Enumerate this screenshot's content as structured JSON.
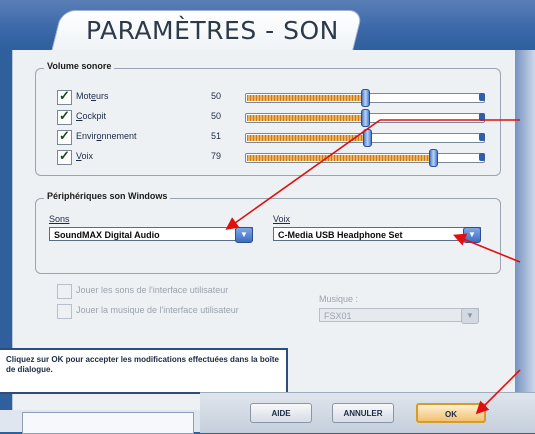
{
  "window": {
    "title": "PARAMÈTRES - SON"
  },
  "volume_group": {
    "title": "Volume sonore",
    "rows": [
      {
        "label_pre": "Mot",
        "label_ul": "e",
        "label_post": "urs",
        "value": "50",
        "level": 0.5,
        "checked": true
      },
      {
        "label_pre": "",
        "label_ul": "C",
        "label_post": "ockpit",
        "value": "50",
        "level": 0.5,
        "checked": true
      },
      {
        "label_pre": "Envir",
        "label_ul": "o",
        "label_post": "nnement",
        "value": "51",
        "level": 0.51,
        "checked": true
      },
      {
        "label_pre": "",
        "label_ul": "V",
        "label_post": "oix",
        "value": "79",
        "level": 0.79,
        "checked": true
      }
    ]
  },
  "devices_group": {
    "title": "Périphériques son Windows",
    "sounds_label": "Sons",
    "sounds_value": "SoundMAX Digital Audio",
    "voice_label": "Voix",
    "voice_value": "C-Media USB Headphone Set"
  },
  "options": {
    "ui_sounds_label": "Jouer les sons de l'interface utilisateur",
    "ui_music_label": "Jouer la musique de l'interface utilisateur",
    "music_label": "Musique :",
    "music_value": "FSX01"
  },
  "info_text": "Cliquez sur OK pour accepter les modifications effectuées dans la boîte de dialogue.",
  "buttons": {
    "help": "AIDE",
    "cancel": "ANNULER",
    "ok": "OK"
  },
  "colors": {
    "accent": "#2f5f9c",
    "annotation": "#e01010",
    "slider_fill": "#f0b259"
  }
}
